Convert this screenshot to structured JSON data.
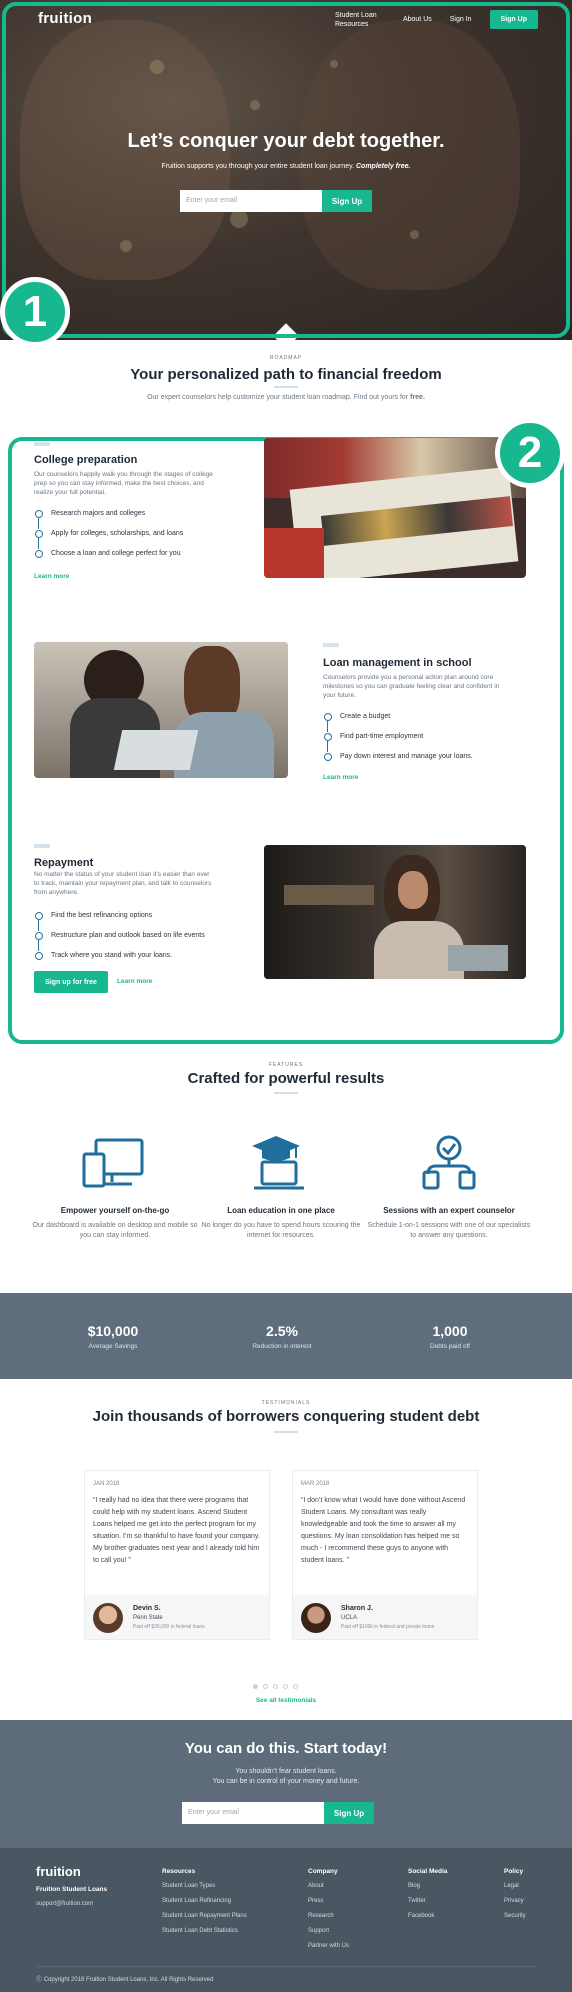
{
  "nav": {
    "logo": "fruition",
    "links": [
      "Student Loan Resources",
      "About Us",
      "Sign In"
    ],
    "signup": "Sign Up"
  },
  "hero": {
    "title": "Let’s conquer your debt together.",
    "subtitle": "Fruition supports you through your entire student loan journey.",
    "subtitle_emphasis": "Completely free.",
    "email_placeholder": "Enter your email",
    "button": "Sign Up",
    "badge": "1"
  },
  "roadmap": {
    "eyebrow": "ROADMAP",
    "title": "Your personalized path to financial freedom",
    "subtitle": "Our expert counselors help customize your student loan roadmap. Find out yours for",
    "subtitle_emphasis": "free.",
    "badge": "2",
    "cards": [
      {
        "title": "College preparation",
        "description": "Our counselors happily walk you through the stages of college prep so you can stay informed, make the best choices, and realize your full potential.",
        "items": [
          "Research majors and colleges",
          "Apply for colleges, scholarships, and loans",
          "Choose a loan and college perfect for you"
        ],
        "link": "Learn more",
        "image": "university-of-chicago-brochures"
      },
      {
        "title": "Loan management in school",
        "description": "Counselors provide you a personal action plan around core milestones so you can graduate feeling clear and confident in your future.",
        "items": [
          "Create a budget",
          "Find part-time employment",
          "Pay down interest and manage your loans."
        ],
        "link": "Learn more",
        "image": "students-laughing-at-laptop"
      },
      {
        "title": "Repayment",
        "description": "No matter the status of your student loan it’s easier than ever to track, maintain your repayment plan, and talk to counselors from anywhere.",
        "items": [
          "Find the best refinancing options",
          "Restructure plan and outlook based on life events",
          "Track where you stand with your loans."
        ],
        "button": "Sign up for free",
        "link": "Learn more",
        "image": "woman-on-phone-in-cafe"
      }
    ]
  },
  "features": {
    "eyebrow": "FEATURES",
    "title": "Crafted for powerful results",
    "items": [
      {
        "icon": "devices-icon",
        "title": "Empower yourself on-the-go",
        "description": "Our dashboard is available on desktop and mobile so you can stay informed."
      },
      {
        "icon": "graduation-laptop-icon",
        "title": "Loan education in one place",
        "description": "No longer do you have to spend hours scouring the internet for resources."
      },
      {
        "icon": "counselor-icon",
        "title": "Sessions with an expert counselor",
        "description": "Schedule 1-on-1 sessions with one of our specialists to answer any questions."
      }
    ]
  },
  "stats": [
    {
      "value": "$10,000",
      "label": "Average Savings"
    },
    {
      "value": "2.5%",
      "label": "Reduction in interest"
    },
    {
      "value": "1,000",
      "label": "Debts paid off"
    }
  ],
  "testimonials": {
    "eyebrow": "TESTIMONIALS",
    "title": "Join thousands of borrowers conquering student debt",
    "items": [
      {
        "date": "JAN 2018",
        "quote": "“I really had no idea that there were programs that could help with my student loans. Ascend Student Loans helped me get into the perfect program for my situation. I’m so thankful to have found your company. My brother graduates next year and I already told him to call you! ”",
        "name": "Devin S.",
        "school": "Penn State",
        "detail": "Paid off $35,000 in federal loans"
      },
      {
        "date": "MAR 2018",
        "quote": "“I don’t know what I would have done without Ascend Student Loans. My consultant was really knowledgeable and took the time to answer all my questions. My loan consolidation has helped me so much - I recommend these guys to anyone with student loans. ”",
        "name": "Sharon J.",
        "school": "UCLA",
        "detail": "Paid off $100k in federal and private loans"
      }
    ],
    "see_all": "See all testimonials"
  },
  "cta": {
    "title": "You can do this. Start today!",
    "line1": "You shouldn’t fear student loans.",
    "line2": "You can be in control of your money and future.",
    "email_placeholder": "Enter your email",
    "button": "Sign Up"
  },
  "footer": {
    "logo": "fruition",
    "company_name": "Fruition Student Loans",
    "email": "support@fruition.com",
    "columns": [
      {
        "heading": "Resources",
        "links": [
          "Student Loan Types",
          "Student Loan Refinancing",
          "Student Loan Repayment Plans",
          "Student Loan Debt Statistics"
        ]
      },
      {
        "heading": "Company",
        "links": [
          "About",
          "Press",
          "Research",
          "Support",
          "Partner with Us"
        ]
      },
      {
        "heading": "Social Media",
        "links": [
          "Blog",
          "Twitter",
          "Facebook"
        ]
      },
      {
        "heading": "Policy",
        "links": [
          "Legal",
          "Privacy",
          "Security"
        ]
      }
    ],
    "copyright": "Copyright 2018 Fruition Student Loans, Inc. All Rights Reserved"
  },
  "colors": {
    "accent": "#17b890",
    "icon_blue": "#1f6e9c",
    "stats_bg": "#5f6e7d",
    "footer_bg": "#4b5663"
  }
}
